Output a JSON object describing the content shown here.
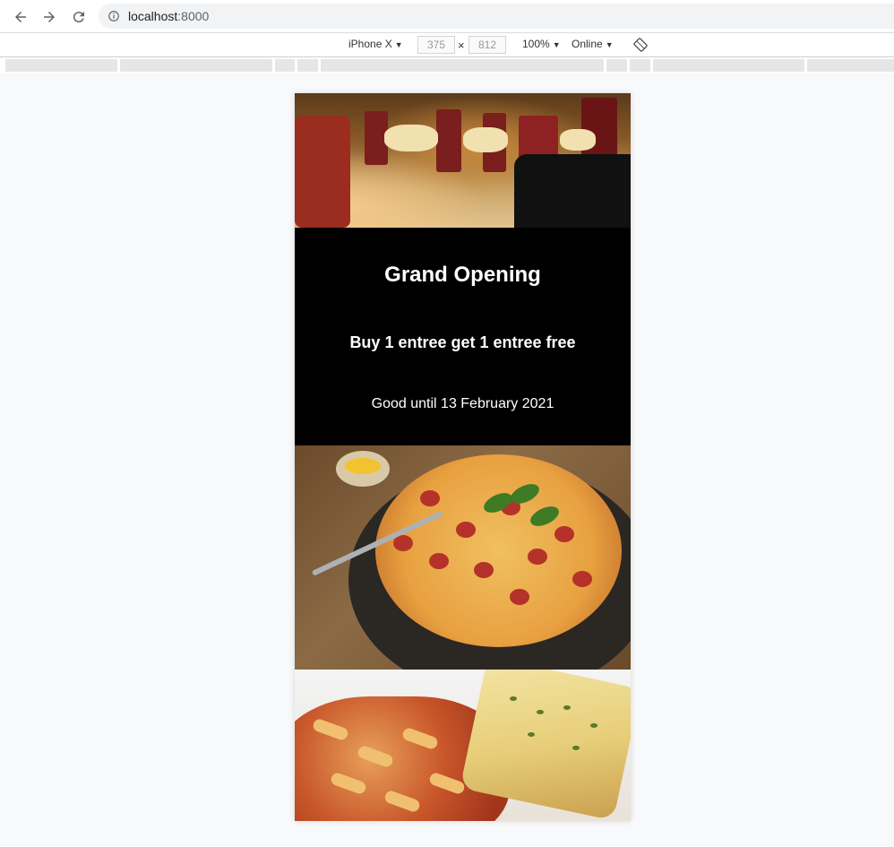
{
  "browser": {
    "url_host": "localhost",
    "url_port": ":8000"
  },
  "devtools": {
    "device": "iPhone X",
    "width": "375",
    "height": "812",
    "times": "×",
    "zoom": "100%",
    "network": "Online"
  },
  "promo": {
    "title": "Grand Opening",
    "offer": "Buy 1 entree get 1 entree free",
    "validity": "Good until 13 February 2021"
  },
  "colors": {
    "promo_bg": "#000000",
    "promo_text": "#ffffff",
    "page_bg": "#f8f9fa"
  },
  "icons": [
    "back-icon",
    "forward-icon",
    "reload-icon",
    "info-icon",
    "rotate-icon"
  ]
}
